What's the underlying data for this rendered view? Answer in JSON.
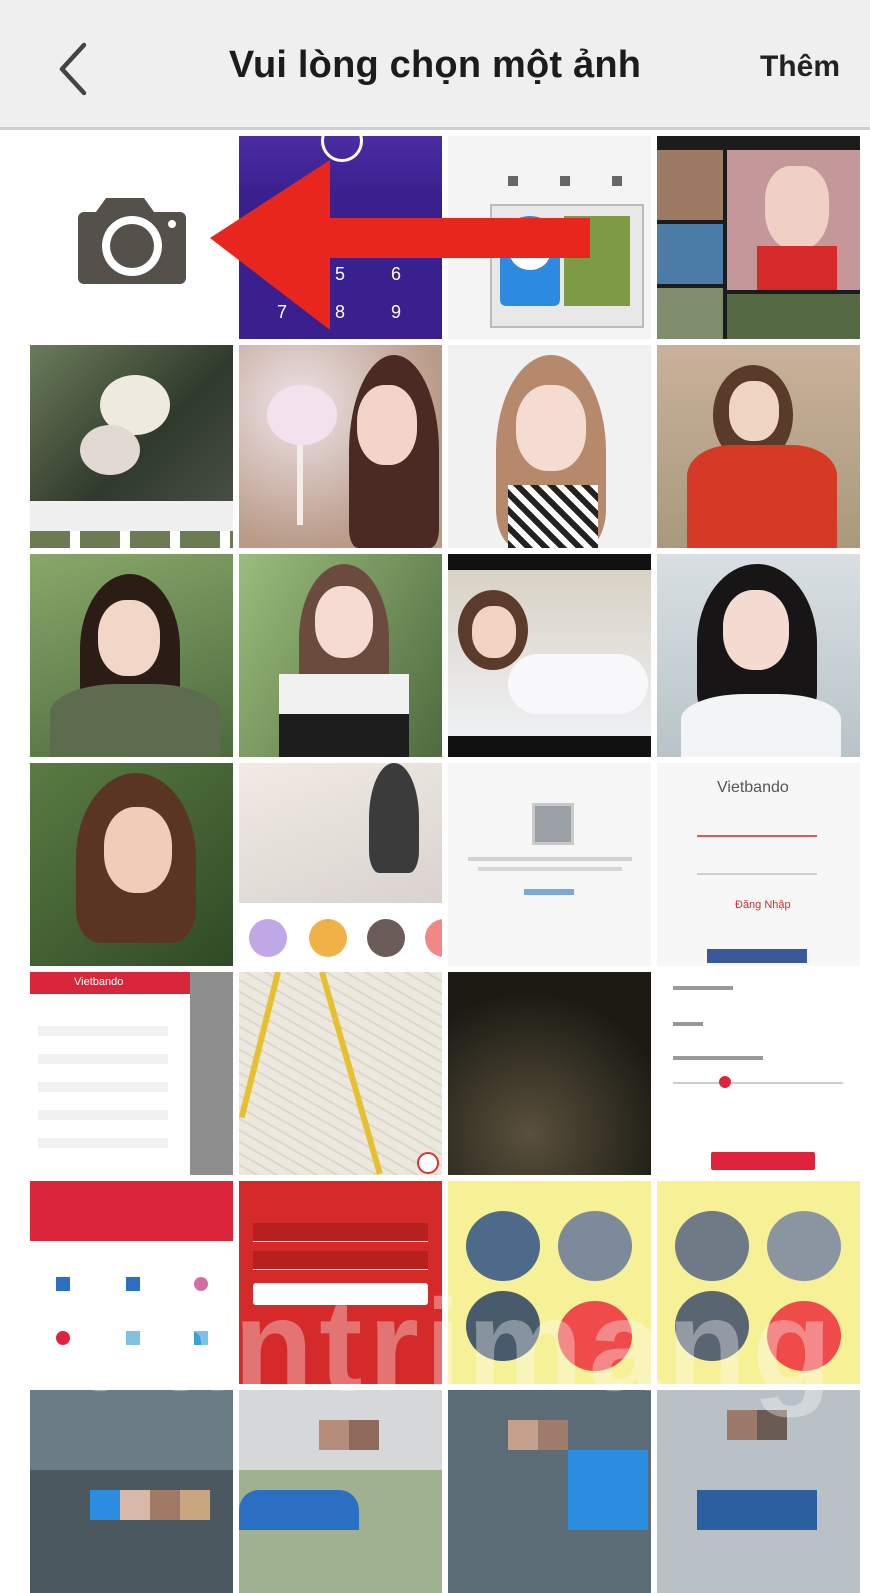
{
  "header": {
    "title": "Vui lòng chọn một ảnh",
    "more_label": "Thêm"
  },
  "icons": {
    "back": "chevron-left-icon",
    "camera": "camera-icon",
    "annotation": "red-arrow-left"
  },
  "tiles": {
    "lock_numbers": [
      "5",
      "6",
      "7",
      "8",
      "9"
    ],
    "vietbando_title": "Vietbando",
    "vietbando_login": "Đăng Nhập",
    "vietbando_menu_title": "Vietbando"
  },
  "watermark": "uantrimang",
  "colors": {
    "accent": "#e52a2a",
    "camera": "#555049",
    "header_bg": "#efefef"
  }
}
